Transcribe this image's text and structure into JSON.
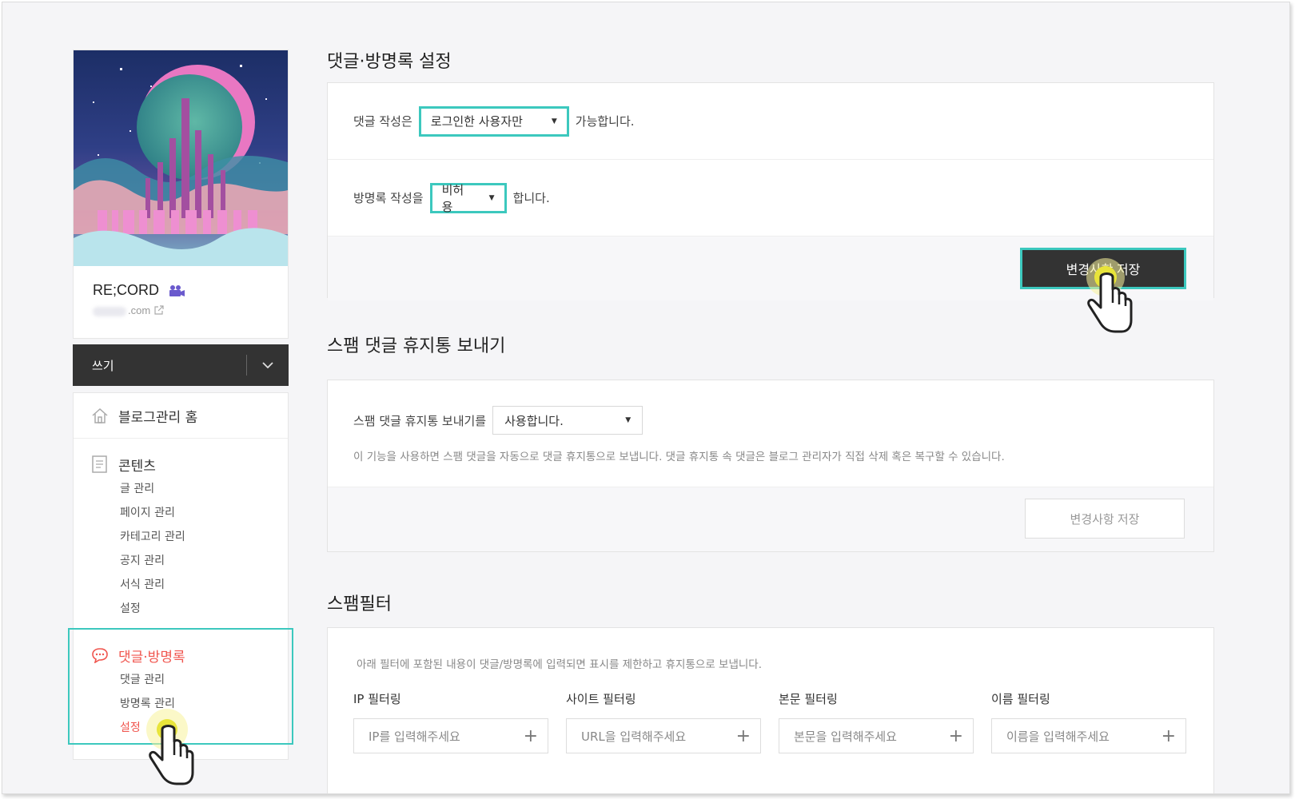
{
  "sidebar": {
    "blog_name": "RE;CORD",
    "blog_url_suffix": ".com",
    "write_label": "쓰기",
    "home_label": "블로그관리 홈",
    "content_section": {
      "title": "콘텐츠",
      "items": [
        "글 관리",
        "페이지 관리",
        "카테고리 관리",
        "공지 관리",
        "서식 관리",
        "설정"
      ]
    },
    "comment_section": {
      "title": "댓글·방명록",
      "items": [
        "댓글 관리",
        "방명록 관리",
        "설정"
      ]
    }
  },
  "comment_settings": {
    "title": "댓글·방명록 설정",
    "comment_prefix": "댓글 작성은",
    "comment_option": "로그인한 사용자만",
    "comment_suffix": "가능합니다.",
    "guestbook_prefix": "방명록 작성을",
    "guestbook_option": "비허용",
    "guestbook_suffix": "합니다.",
    "save_label": "변경사항 저장"
  },
  "spam_trash": {
    "title": "스팸 댓글 휴지통 보내기",
    "label": "스팸 댓글 휴지통 보내기를",
    "option": "사용합니다.",
    "description": "이 기능을 사용하면 스팸 댓글을 자동으로 댓글 휴지통으로 보냅니다. 댓글 휴지통 속 댓글은 블로그 관리자가 직접 삭제 혹은 복구할 수 있습니다.",
    "save_label": "변경사항 저장"
  },
  "spam_filter": {
    "title": "스팸필터",
    "description": "아래 필터에 포함된 내용이 댓글/방명록에 입력되면 표시를 제한하고 휴지통으로 보냅니다.",
    "filters": [
      {
        "label": "IP 필터링",
        "placeholder": "IP를 입력해주세요"
      },
      {
        "label": "사이트 필터링",
        "placeholder": "URL을 입력해주세요"
      },
      {
        "label": "본문 필터링",
        "placeholder": "본문을 입력해주세요"
      },
      {
        "label": "이름 필터링",
        "placeholder": "이름을 입력해주세요"
      }
    ]
  },
  "colors": {
    "highlight": "#3cc8be",
    "accent_red": "#f0554e",
    "dark_button": "#333333"
  }
}
